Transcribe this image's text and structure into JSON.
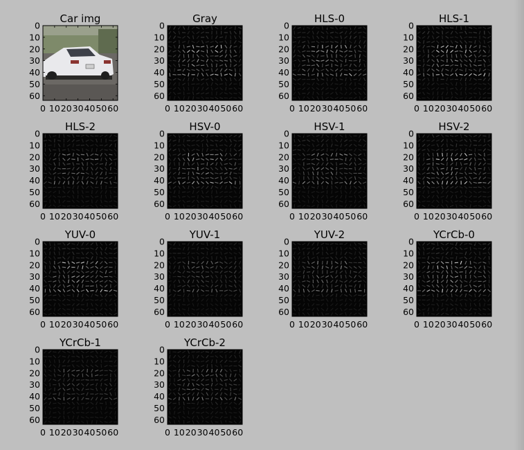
{
  "figure": {
    "background": "#bfbfbf",
    "ylim": [
      64,
      0
    ],
    "xlim": [
      0,
      64
    ],
    "ytick_labels": [
      "0",
      "10",
      "20",
      "30",
      "40",
      "50",
      "60"
    ],
    "xtick_labels": [
      "0",
      "10",
      "20",
      "30",
      "40",
      "50",
      "60"
    ]
  },
  "chart_data": [
    {
      "type": "heatmap",
      "title": "Car img",
      "kind": "photo"
    },
    {
      "type": "heatmap",
      "title": "Gray",
      "kind": "hog",
      "intensity": 0.85
    },
    {
      "type": "heatmap",
      "title": "HLS-0",
      "kind": "hog",
      "intensity": 0.75
    },
    {
      "type": "heatmap",
      "title": "HLS-1",
      "kind": "hog",
      "intensity": 0.85
    },
    {
      "type": "heatmap",
      "title": "HLS-2",
      "kind": "hog",
      "intensity": 0.55
    },
    {
      "type": "heatmap",
      "title": "HSV-0",
      "kind": "hog",
      "intensity": 0.75
    },
    {
      "type": "heatmap",
      "title": "HSV-1",
      "kind": "hog",
      "intensity": 0.6
    },
    {
      "type": "heatmap",
      "title": "HSV-2",
      "kind": "hog",
      "intensity": 0.85
    },
    {
      "type": "heatmap",
      "title": "YUV-0",
      "kind": "hog",
      "intensity": 0.85
    },
    {
      "type": "heatmap",
      "title": "YUV-1",
      "kind": "hog",
      "intensity": 0.45
    },
    {
      "type": "heatmap",
      "title": "YUV-2",
      "kind": "hog",
      "intensity": 0.55
    },
    {
      "type": "heatmap",
      "title": "YCrCb-0",
      "kind": "hog",
      "intensity": 0.85
    },
    {
      "type": "heatmap",
      "title": "YCrCb-1",
      "kind": "hog",
      "intensity": 0.4
    },
    {
      "type": "heatmap",
      "title": "YCrCb-2",
      "kind": "hog",
      "intensity": 0.55
    }
  ]
}
